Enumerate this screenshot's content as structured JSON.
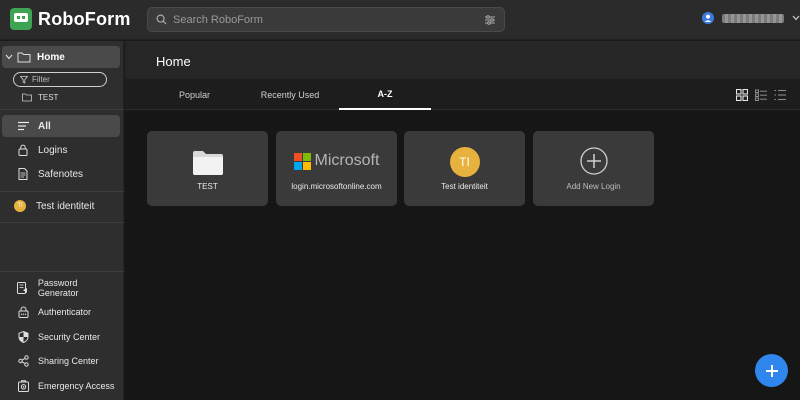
{
  "app": {
    "name": "RoboForm"
  },
  "search": {
    "placeholder": "Search RoboForm"
  },
  "sidebar": {
    "home_label": "Home",
    "filter_placeholder": "Filter",
    "folder_label": "TEST",
    "items": [
      {
        "label": "All",
        "icon": "list-icon"
      },
      {
        "label": "Logins",
        "icon": "lock-icon"
      },
      {
        "label": "Safenotes",
        "icon": "note-icon"
      }
    ],
    "identity": {
      "label": "Test identiteit",
      "initials": "TI"
    },
    "bottom_items": [
      {
        "label": "Password Generator",
        "icon": "password-generator-icon"
      },
      {
        "label": "Authenticator",
        "icon": "authenticator-icon"
      },
      {
        "label": "Security Center",
        "icon": "shield-icon"
      },
      {
        "label": "Sharing Center",
        "icon": "share-icon"
      },
      {
        "label": "Emergency Access",
        "icon": "emergency-icon"
      }
    ]
  },
  "main": {
    "title": "Home",
    "tabs": [
      {
        "label": "Popular"
      },
      {
        "label": "Recently Used"
      },
      {
        "label": "A-Z"
      }
    ],
    "active_tab": "A-Z",
    "cards": [
      {
        "label": "TEST",
        "type": "folder"
      },
      {
        "label": "login.microsoftonline.com",
        "type": "login",
        "logo_text": "Microsoft"
      },
      {
        "label": "Test identiteit",
        "type": "identity",
        "initials": "TI"
      },
      {
        "label": "Add New Login",
        "type": "add"
      }
    ]
  },
  "colors": {
    "brand_green": "#3ea352",
    "identity_avatar": "#e6b13d",
    "fab_blue": "#2f86ec",
    "ms_red": "#f25022",
    "ms_green": "#7fba00",
    "ms_blue": "#00a4ef",
    "ms_yellow": "#ffb900"
  }
}
